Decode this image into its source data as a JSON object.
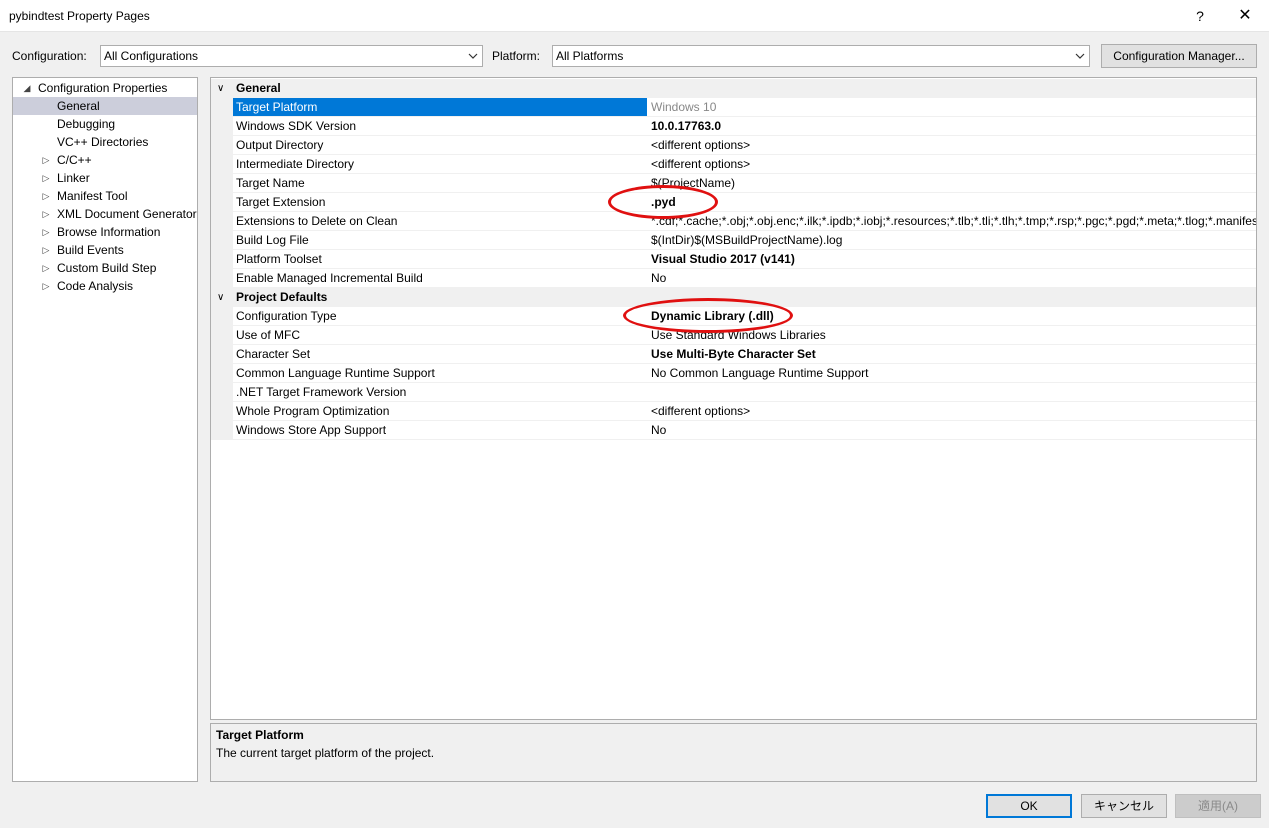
{
  "window": {
    "title": "pybindtest Property Pages",
    "help_label": "?",
    "close_label": "✕"
  },
  "toolbar": {
    "configuration_label": "Configuration:",
    "configuration_value": "All Configurations",
    "platform_label": "Platform:",
    "platform_value": "All Platforms",
    "config_manager_label": "Configuration Manager..."
  },
  "tree": {
    "root": "Configuration Properties",
    "items": [
      {
        "label": "General",
        "expandable": false,
        "selected": true
      },
      {
        "label": "Debugging",
        "expandable": false
      },
      {
        "label": "VC++ Directories",
        "expandable": false
      },
      {
        "label": "C/C++",
        "expandable": true
      },
      {
        "label": "Linker",
        "expandable": true
      },
      {
        "label": "Manifest Tool",
        "expandable": true
      },
      {
        "label": "XML Document Generator",
        "expandable": true
      },
      {
        "label": "Browse Information",
        "expandable": true
      },
      {
        "label": "Build Events",
        "expandable": true
      },
      {
        "label": "Custom Build Step",
        "expandable": true
      },
      {
        "label": "Code Analysis",
        "expandable": true
      }
    ]
  },
  "grid": {
    "general_label": "General",
    "general_rows": [
      {
        "name": "Target Platform",
        "value": "Windows 10"
      },
      {
        "name": "Windows SDK Version",
        "value": "10.0.17763.0"
      },
      {
        "name": "Output Directory",
        "value": "<different options>"
      },
      {
        "name": "Intermediate Directory",
        "value": "<different options>"
      },
      {
        "name": "Target Name",
        "value": "$(ProjectName)"
      },
      {
        "name": "Target Extension",
        "value": ".pyd"
      },
      {
        "name": "Extensions to Delete on Clean",
        "value": "*.cdf;*.cache;*.obj;*.obj.enc;*.ilk;*.ipdb;*.iobj;*.resources;*.tlb;*.tli;*.tlh;*.tmp;*.rsp;*.pgc;*.pgd;*.meta;*.tlog;*.manifest"
      },
      {
        "name": "Build Log File",
        "value": "$(IntDir)$(MSBuildProjectName).log"
      },
      {
        "name": "Platform Toolset",
        "value": "Visual Studio 2017 (v141)"
      },
      {
        "name": "Enable Managed Incremental Build",
        "value": "No"
      }
    ],
    "defaults_label": "Project Defaults",
    "defaults_rows": [
      {
        "name": "Configuration Type",
        "value": "Dynamic Library (.dll)"
      },
      {
        "name": "Use of MFC",
        "value": "Use Standard Windows Libraries"
      },
      {
        "name": "Character Set",
        "value": "Use Multi-Byte Character Set"
      },
      {
        "name": "Common Language Runtime Support",
        "value": "No Common Language Runtime Support"
      },
      {
        "name": ".NET Target Framework Version",
        "value": ""
      },
      {
        "name": "Whole Program Optimization",
        "value": "<different options>"
      },
      {
        "name": "Windows Store App Support",
        "value": "No"
      }
    ]
  },
  "description": {
    "title": "Target Platform",
    "text": "The current target platform of the project."
  },
  "buttons": {
    "ok": "OK",
    "cancel": "キャンセル",
    "apply": "適用(A)"
  },
  "colors": {
    "selection": "#0078d7",
    "annotation": "#e01010",
    "tree_selection": "#cccedb"
  }
}
